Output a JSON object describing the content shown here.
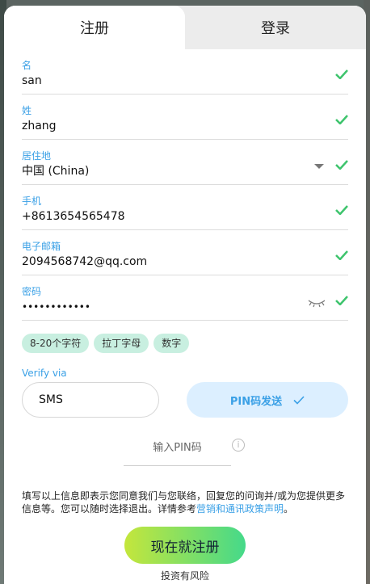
{
  "tabs": {
    "register": "注册",
    "login": "登录"
  },
  "fields": {
    "first_name": {
      "label": "名",
      "value": "san"
    },
    "last_name": {
      "label": "姓",
      "value": "zhang"
    },
    "residence": {
      "label": "居住地",
      "value": "中国 (China)"
    },
    "phone": {
      "label": "手机",
      "value": "+8613654565478"
    },
    "email": {
      "label": "电子邮箱",
      "value": "2094568742@qq.com"
    },
    "password": {
      "label": "密码",
      "value": "••••••••••••"
    }
  },
  "password_rules": [
    "8-20个字符",
    "拉丁字母",
    "数字"
  ],
  "verify": {
    "label": "Verify via",
    "method": "SMS",
    "pin_button": "PIN码发送",
    "pin_placeholder": "输入PIN码"
  },
  "notice": {
    "text": "填写以上信息即表示您同意我们与您联络，回复您的问询并/或为您提供更多信息等。您可以随时选择退出。详情参考",
    "link": "营销和通讯政策声明",
    "end": "。"
  },
  "submit_label": "现在就注册",
  "risk_text": "投资有风险",
  "colors": {
    "accent": "#3aa0e6",
    "check": "#3ec46d",
    "chip": "#c8efe0",
    "pin_button_bg": "#dcefff"
  }
}
